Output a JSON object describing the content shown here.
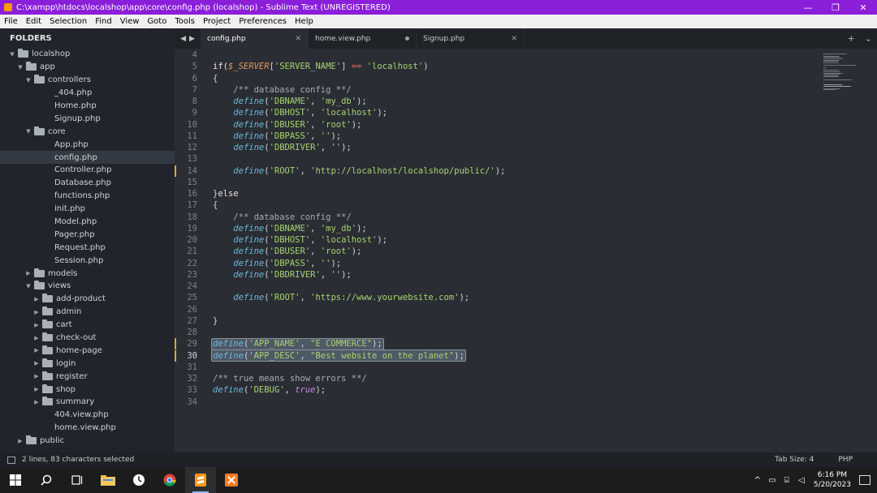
{
  "window": {
    "title": "C:\\xampp\\htdocs\\localshop\\app\\core\\config.php (localshop) - Sublime Text (UNREGISTERED)",
    "minimize": "—",
    "maximize": "❐",
    "close": "✕"
  },
  "menu": [
    "File",
    "Edit",
    "Selection",
    "Find",
    "View",
    "Goto",
    "Tools",
    "Project",
    "Preferences",
    "Help"
  ],
  "sidebar": {
    "header": "FOLDERS",
    "tree": [
      {
        "label": "localshop",
        "type": "folder",
        "depth": 0,
        "expanded": true
      },
      {
        "label": "app",
        "type": "folder",
        "depth": 1,
        "expanded": true
      },
      {
        "label": "controllers",
        "type": "folder",
        "depth": 2,
        "expanded": true
      },
      {
        "label": "_404.php",
        "type": "file",
        "depth": 3
      },
      {
        "label": "Home.php",
        "type": "file",
        "depth": 3
      },
      {
        "label": "Signup.php",
        "type": "file",
        "depth": 3
      },
      {
        "label": "core",
        "type": "folder",
        "depth": 2,
        "expanded": true
      },
      {
        "label": "App.php",
        "type": "file",
        "depth": 3
      },
      {
        "label": "config.php",
        "type": "file",
        "depth": 3,
        "selected": true
      },
      {
        "label": "Controller.php",
        "type": "file",
        "depth": 3
      },
      {
        "label": "Database.php",
        "type": "file",
        "depth": 3
      },
      {
        "label": "functions.php",
        "type": "file",
        "depth": 3
      },
      {
        "label": "init.php",
        "type": "file",
        "depth": 3
      },
      {
        "label": "Model.php",
        "type": "file",
        "depth": 3
      },
      {
        "label": "Pager.php",
        "type": "file",
        "depth": 3
      },
      {
        "label": "Request.php",
        "type": "file",
        "depth": 3
      },
      {
        "label": "Session.php",
        "type": "file",
        "depth": 3
      },
      {
        "label": "models",
        "type": "folder",
        "depth": 2,
        "expanded": false
      },
      {
        "label": "views",
        "type": "folder",
        "depth": 2,
        "expanded": true
      },
      {
        "label": "add-product",
        "type": "folder",
        "depth": 3,
        "expanded": false
      },
      {
        "label": "admin",
        "type": "folder",
        "depth": 3,
        "expanded": false
      },
      {
        "label": "cart",
        "type": "folder",
        "depth": 3,
        "expanded": false
      },
      {
        "label": "check-out",
        "type": "folder",
        "depth": 3,
        "expanded": false
      },
      {
        "label": "home-page",
        "type": "folder",
        "depth": 3,
        "expanded": false
      },
      {
        "label": "login",
        "type": "folder",
        "depth": 3,
        "expanded": false
      },
      {
        "label": "register",
        "type": "folder",
        "depth": 3,
        "expanded": false
      },
      {
        "label": "shop",
        "type": "folder",
        "depth": 3,
        "expanded": false
      },
      {
        "label": "summary",
        "type": "folder",
        "depth": 3,
        "expanded": false
      },
      {
        "label": "404.view.php",
        "type": "file",
        "depth": 3
      },
      {
        "label": "home.view.php",
        "type": "file",
        "depth": 3
      },
      {
        "label": "public",
        "type": "folder",
        "depth": 1,
        "expanded": false
      }
    ]
  },
  "tabs": [
    {
      "label": "config.php",
      "active": true,
      "state": "close"
    },
    {
      "label": "home.view.php",
      "active": false,
      "state": "dirty"
    },
    {
      "label": "Signup.php",
      "active": false,
      "state": "close"
    }
  ],
  "tab_tools": {
    "add": "+",
    "more": "⌄"
  },
  "editor": {
    "lines": [
      {
        "n": 4,
        "t": []
      },
      {
        "n": 5,
        "t": [
          [
            "kw",
            "if("
          ],
          [
            "var",
            "$_SERVER"
          ],
          [
            "pl",
            "["
          ],
          [
            "str",
            "'SERVER_NAME'"
          ],
          [
            "pl",
            "] "
          ],
          [
            "op",
            "=="
          ],
          [
            "pl",
            " "
          ],
          [
            "str",
            "'localhost'"
          ],
          [
            "pl",
            ")"
          ]
        ]
      },
      {
        "n": 6,
        "t": [
          [
            "pl",
            "{"
          ]
        ]
      },
      {
        "n": 7,
        "t": [
          [
            "pl",
            "    "
          ],
          [
            "cm",
            "/** database config **/"
          ]
        ]
      },
      {
        "n": 8,
        "t": [
          [
            "pl",
            "    "
          ],
          [
            "fn",
            "define"
          ],
          [
            "pl",
            "("
          ],
          [
            "str",
            "'DBNAME'"
          ],
          [
            "pl",
            ", "
          ],
          [
            "str",
            "'my_db'"
          ],
          [
            "pl",
            ");"
          ]
        ]
      },
      {
        "n": 9,
        "t": [
          [
            "pl",
            "    "
          ],
          [
            "fn",
            "define"
          ],
          [
            "pl",
            "("
          ],
          [
            "str",
            "'DBHOST'"
          ],
          [
            "pl",
            ", "
          ],
          [
            "str",
            "'localhost'"
          ],
          [
            "pl",
            ");"
          ]
        ]
      },
      {
        "n": 10,
        "t": [
          [
            "pl",
            "    "
          ],
          [
            "fn",
            "define"
          ],
          [
            "pl",
            "("
          ],
          [
            "str",
            "'DBUSER'"
          ],
          [
            "pl",
            ", "
          ],
          [
            "str",
            "'root'"
          ],
          [
            "pl",
            ");"
          ]
        ]
      },
      {
        "n": 11,
        "t": [
          [
            "pl",
            "    "
          ],
          [
            "fn",
            "define"
          ],
          [
            "pl",
            "("
          ],
          [
            "str",
            "'DBPASS'"
          ],
          [
            "pl",
            ", "
          ],
          [
            "str",
            "''"
          ],
          [
            "pl",
            ");"
          ]
        ]
      },
      {
        "n": 12,
        "t": [
          [
            "pl",
            "    "
          ],
          [
            "fn",
            "define"
          ],
          [
            "pl",
            "("
          ],
          [
            "str",
            "'DBDRIVER'"
          ],
          [
            "pl",
            ", "
          ],
          [
            "str",
            "''"
          ],
          [
            "pl",
            ");"
          ]
        ]
      },
      {
        "n": 13,
        "t": []
      },
      {
        "n": 14,
        "t": [
          [
            "pl",
            "    "
          ],
          [
            "fn",
            "define"
          ],
          [
            "pl",
            "("
          ],
          [
            "str",
            "'ROOT'"
          ],
          [
            "pl",
            ", "
          ],
          [
            "str",
            "'http://localhost/localshop/public/'"
          ],
          [
            "pl",
            ");"
          ]
        ],
        "modified": true
      },
      {
        "n": 15,
        "t": []
      },
      {
        "n": 16,
        "t": [
          [
            "pl",
            "}"
          ],
          [
            "kw",
            "else"
          ]
        ]
      },
      {
        "n": 17,
        "t": [
          [
            "pl",
            "{"
          ]
        ]
      },
      {
        "n": 18,
        "t": [
          [
            "pl",
            "    "
          ],
          [
            "cm",
            "/** database config **/"
          ]
        ]
      },
      {
        "n": 19,
        "t": [
          [
            "pl",
            "    "
          ],
          [
            "fn",
            "define"
          ],
          [
            "pl",
            "("
          ],
          [
            "str",
            "'DBNAME'"
          ],
          [
            "pl",
            ", "
          ],
          [
            "str",
            "'my_db'"
          ],
          [
            "pl",
            ");"
          ]
        ]
      },
      {
        "n": 20,
        "t": [
          [
            "pl",
            "    "
          ],
          [
            "fn",
            "define"
          ],
          [
            "pl",
            "("
          ],
          [
            "str",
            "'DBHOST'"
          ],
          [
            "pl",
            ", "
          ],
          [
            "str",
            "'localhost'"
          ],
          [
            "pl",
            ");"
          ]
        ]
      },
      {
        "n": 21,
        "t": [
          [
            "pl",
            "    "
          ],
          [
            "fn",
            "define"
          ],
          [
            "pl",
            "("
          ],
          [
            "str",
            "'DBUSER'"
          ],
          [
            "pl",
            ", "
          ],
          [
            "str",
            "'root'"
          ],
          [
            "pl",
            ");"
          ]
        ]
      },
      {
        "n": 22,
        "t": [
          [
            "pl",
            "    "
          ],
          [
            "fn",
            "define"
          ],
          [
            "pl",
            "("
          ],
          [
            "str",
            "'DBPASS'"
          ],
          [
            "pl",
            ", "
          ],
          [
            "str",
            "''"
          ],
          [
            "pl",
            ");"
          ]
        ]
      },
      {
        "n": 23,
        "t": [
          [
            "pl",
            "    "
          ],
          [
            "fn",
            "define"
          ],
          [
            "pl",
            "("
          ],
          [
            "str",
            "'DBDRIVER'"
          ],
          [
            "pl",
            ", "
          ],
          [
            "str",
            "''"
          ],
          [
            "pl",
            ");"
          ]
        ]
      },
      {
        "n": 24,
        "t": []
      },
      {
        "n": 25,
        "t": [
          [
            "pl",
            "    "
          ],
          [
            "fn",
            "define"
          ],
          [
            "pl",
            "("
          ],
          [
            "str",
            "'ROOT'"
          ],
          [
            "pl",
            ", "
          ],
          [
            "str",
            "'https://www.yourwebsite.com'"
          ],
          [
            "pl",
            ");"
          ]
        ]
      },
      {
        "n": 26,
        "t": []
      },
      {
        "n": 27,
        "t": [
          [
            "pl",
            "}"
          ]
        ]
      },
      {
        "n": 28,
        "t": []
      },
      {
        "n": 29,
        "t": [
          [
            "fn",
            "define"
          ],
          [
            "pl",
            "("
          ],
          [
            "str",
            "'APP_NAME'"
          ],
          [
            "pl",
            ", "
          ],
          [
            "str",
            "\"E COMMERCE\""
          ],
          [
            "pl",
            ");"
          ]
        ],
        "selected": true,
        "modified": true
      },
      {
        "n": 30,
        "t": [
          [
            "fn",
            "define"
          ],
          [
            "pl",
            "("
          ],
          [
            "str",
            "'APP_DESC'"
          ],
          [
            "pl",
            ", "
          ],
          [
            "str",
            "\"Best website on the planet\""
          ],
          [
            "pl",
            ");"
          ]
        ],
        "selected": true,
        "modified": true,
        "current": true
      },
      {
        "n": 31,
        "t": []
      },
      {
        "n": 32,
        "t": [
          [
            "cm",
            "/** true means show errors **/"
          ]
        ]
      },
      {
        "n": 33,
        "t": [
          [
            "fn",
            "define"
          ],
          [
            "pl",
            "("
          ],
          [
            "str",
            "'DEBUG'"
          ],
          [
            "pl",
            ", "
          ],
          [
            "bool",
            "true"
          ],
          [
            "pl",
            ");"
          ]
        ]
      },
      {
        "n": 34,
        "t": []
      }
    ]
  },
  "status": {
    "selection": "2 lines, 83 characters selected",
    "tab_size": "Tab Size: 4",
    "syntax": "PHP"
  },
  "taskbar": {
    "apps": [
      "start-icon",
      "search-icon",
      "task-view-icon",
      "file-explorer-icon",
      "clock-app-icon",
      "chrome-icon",
      "sublime-text-icon",
      "xampp-icon"
    ],
    "time": "6:16 PM",
    "date": "5/20/2023",
    "tray_chevron": "^"
  }
}
